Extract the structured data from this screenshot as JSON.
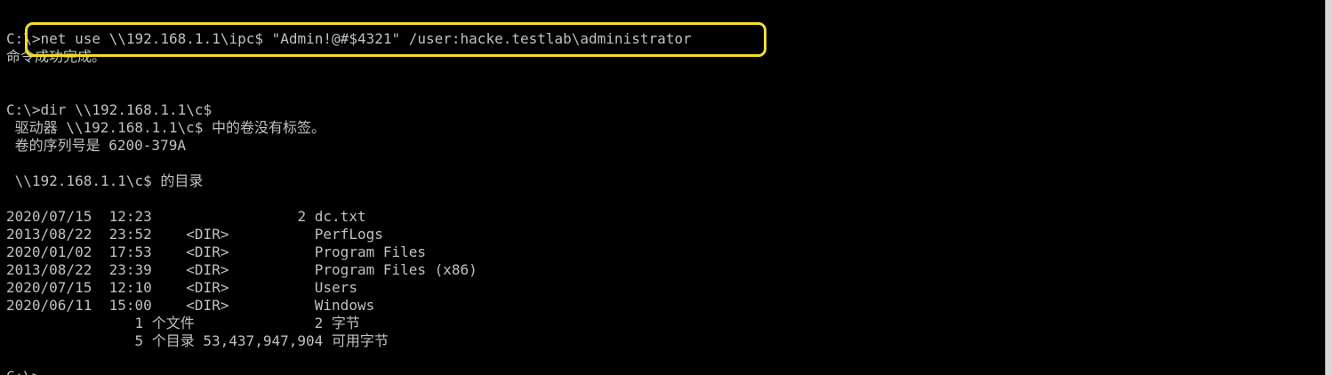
{
  "console": {
    "lines": [
      "C:\\>net use \\\\192.168.1.1\\ipc$ \"Admin!@#$4321\" /user:hacke.testlab\\administrator",
      "命令成功完成。",
      "",
      "",
      "C:\\>dir \\\\192.168.1.1\\c$",
      " 驱动器 \\\\192.168.1.1\\c$ 中的卷没有标签。",
      " 卷的序列号是 6200-379A",
      "",
      " \\\\192.168.1.1\\c$ 的目录",
      "",
      "2020/07/15  12:23                 2 dc.txt",
      "2013/08/22  23:52    <DIR>          PerfLogs",
      "2020/01/02  17:53    <DIR>          Program Files",
      "2013/08/22  23:39    <DIR>          Program Files (x86)",
      "2020/07/15  12:10    <DIR>          Users",
      "2020/06/11  15:00    <DIR>          Windows",
      "               1 个文件              2 字节",
      "               5 个目录 53,437,947,904 可用字节",
      "",
      "C:\\>"
    ]
  },
  "colors": {
    "background": "#000000",
    "text": "#c0c0c0",
    "highlight": "#f2de27"
  }
}
